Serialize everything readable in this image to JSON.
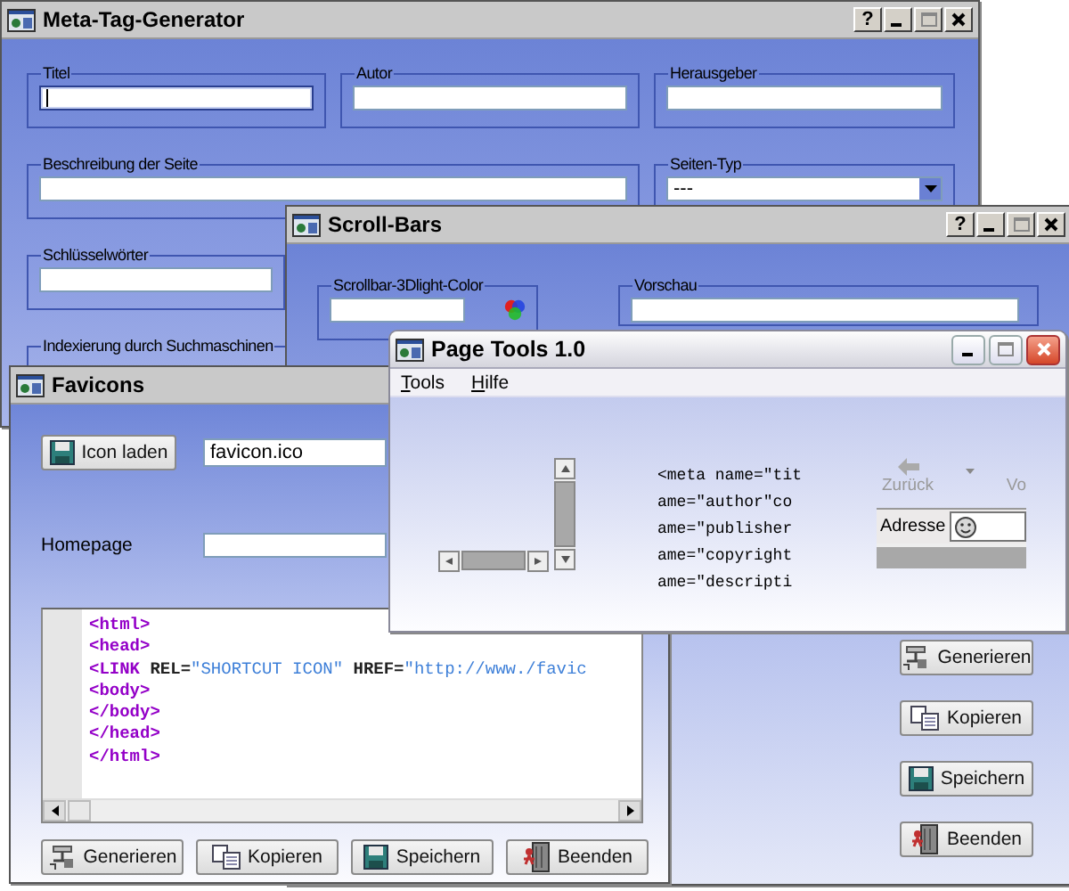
{
  "meta_window": {
    "title": "Meta-Tag-Generator",
    "controls": [
      {
        "kind": "help",
        "label": "?"
      },
      {
        "kind": "minimize"
      },
      {
        "kind": "maximize"
      },
      {
        "kind": "close"
      }
    ],
    "groups": [
      {
        "label": "Titel",
        "kind": "text",
        "focused": true
      },
      {
        "label": "Autor",
        "kind": "text",
        "focused": false
      },
      {
        "label": "Herausgeber",
        "kind": "text",
        "focused": false
      },
      {
        "label": "Beschreibung der Seite",
        "kind": "text",
        "focused": false
      },
      {
        "label": "Seiten-Typ",
        "kind": "select",
        "value": "---"
      },
      {
        "label": "Schlüsselwörter",
        "kind": "text",
        "focused": false
      },
      {
        "label": "Indexierung durch Suchmaschinen",
        "kind": "label"
      }
    ]
  },
  "scroll_window": {
    "title": "Scroll-Bars",
    "controls": [
      {
        "kind": "help",
        "label": "?"
      },
      {
        "kind": "minimize"
      },
      {
        "kind": "maximize"
      },
      {
        "kind": "close"
      }
    ],
    "groups": [
      {
        "label": "Scrollbar-3Dlight-Color",
        "kind": "color"
      },
      {
        "label": "Vorschau",
        "kind": "text"
      }
    ],
    "buttons": [
      {
        "label": "Generieren",
        "kind": "generate"
      },
      {
        "label": "Kopieren",
        "kind": "copy"
      },
      {
        "label": "Speichern",
        "kind": "save"
      },
      {
        "label": "Beenden",
        "kind": "exit"
      }
    ]
  },
  "favicons_window": {
    "title": "Favicons",
    "load_button": "Icon laden",
    "file_value": "favicon.ico",
    "homepage_label": "Homepage",
    "code_lines": [
      [
        {
          "kind": "tag",
          "text": "<html>"
        }
      ],
      [
        {
          "kind": "tag",
          "text": "<head>"
        }
      ],
      [
        {
          "kind": "tag",
          "text": "<LINK"
        },
        {
          "kind": "attr",
          "text": " REL="
        },
        {
          "kind": "string",
          "text": "\"SHORTCUT ICON\""
        },
        {
          "kind": "attr",
          "text": " HREF="
        },
        {
          "kind": "string",
          "text": "\"http://www./favic"
        }
      ],
      [
        {
          "kind": "tag",
          "text": "<body>"
        }
      ],
      [
        {
          "kind": "tag",
          "text": "</body>"
        }
      ],
      [
        {
          "kind": "tag",
          "text": "</head>"
        }
      ],
      [
        {
          "kind": "tag",
          "text": "</html>"
        }
      ]
    ],
    "buttons": [
      {
        "label": "Generieren",
        "kind": "generate"
      },
      {
        "label": "Kopieren",
        "kind": "copy"
      },
      {
        "label": "Speichern",
        "kind": "save"
      },
      {
        "label": "Beenden",
        "kind": "exit"
      }
    ]
  },
  "page_tools_window": {
    "title": "Page Tools 1.0",
    "controls": [
      {
        "kind": "minimize"
      },
      {
        "kind": "maximize"
      },
      {
        "kind": "close"
      }
    ],
    "menu": [
      "Tools",
      "Hilfe"
    ],
    "code_lines": [
      "<meta name=\"tit",
      "ame=\"author\"co",
      "ame=\"publisher",
      "ame=\"copyright",
      "ame=\"descripti"
    ],
    "browser": {
      "back": "Zurück",
      "forward": "Vo",
      "address_label": "Adresse"
    }
  }
}
